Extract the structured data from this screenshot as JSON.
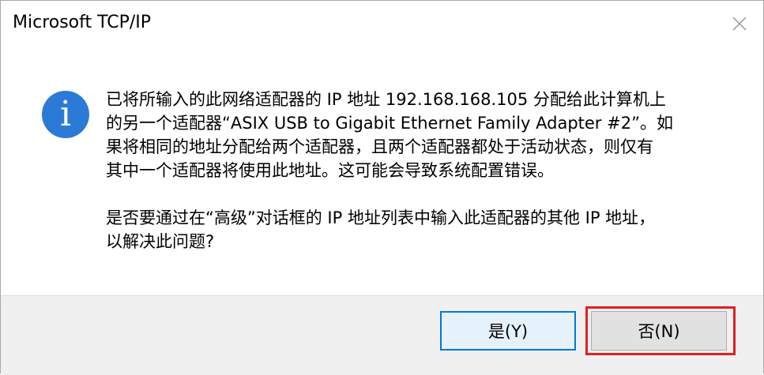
{
  "window": {
    "title": "Microsoft TCP/IP",
    "close_icon": "close-icon"
  },
  "message": {
    "icon": "info-icon",
    "icon_glyph": "i",
    "paragraph1": "已将所输入的此网络适配器的 IP 地址 192.168.168.105 分配给此计算机上\n的另一个适配器“ASIX USB to Gigabit Ethernet Family Adapter #2”。如\n果将相同的地址分配给两个适配器，且两个适配器都处于活动状态，则仅有\n其中一个适配器将使用此地址。这可能会导致系统配置错误。",
    "paragraph2": "是否要通过在“高级”对话框的 IP 地址列表中输入此适配器的其他 IP 地址，\n以解决此问题?"
  },
  "buttons": {
    "yes_label": "是(Y)",
    "no_label": "否(N)"
  },
  "colors": {
    "accent": "#0078d7",
    "info_icon": "#2b7bd6",
    "highlight": "#e02020"
  }
}
